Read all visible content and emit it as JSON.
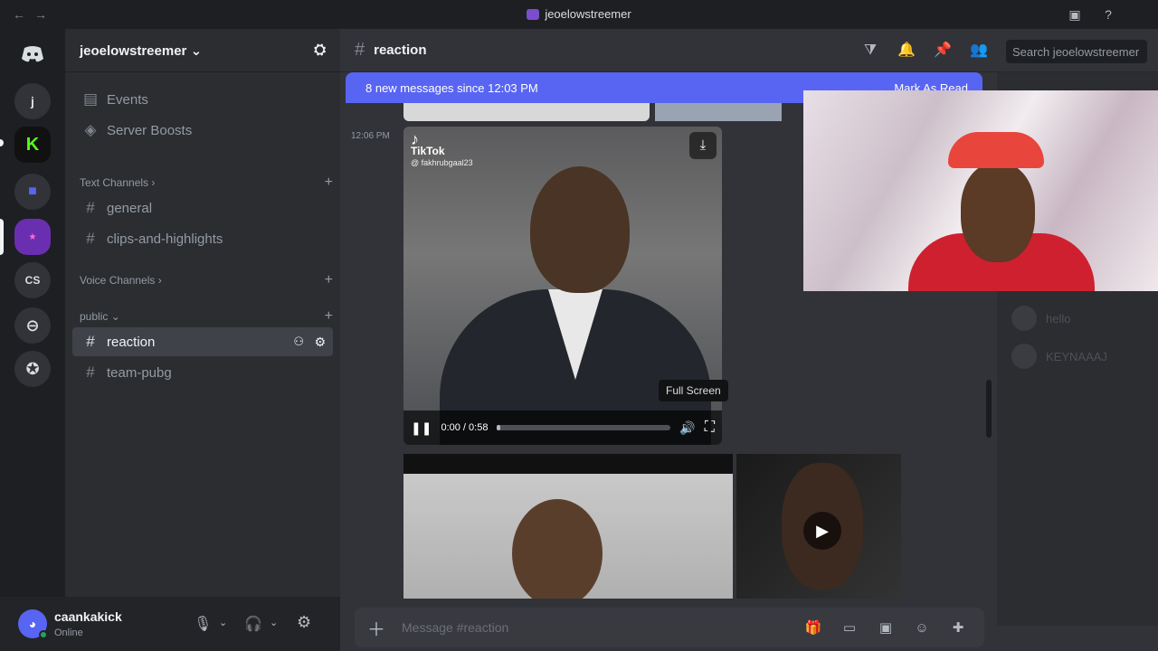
{
  "window": {
    "title": "jeoelowstreemer"
  },
  "guilds": {
    "items": [
      {
        "label": "j"
      },
      {
        "label": "CS"
      }
    ]
  },
  "server": {
    "name": "jeoelowstreemer",
    "menu": [
      {
        "label": "Events",
        "icon": "calendar-icon"
      },
      {
        "label": "Server Boosts",
        "icon": "boost-icon"
      }
    ],
    "categories": {
      "text": "Text Channels",
      "voice": "Voice Channels",
      "public": "public"
    },
    "text_channels": [
      {
        "label": "general"
      },
      {
        "label": "clips-and-highlights"
      }
    ],
    "public_channels": [
      {
        "label": "reaction",
        "active": true
      },
      {
        "label": "team-pubg"
      }
    ]
  },
  "user": {
    "name": "caankakick",
    "status": "Online"
  },
  "channel": {
    "name": "reaction"
  },
  "search": {
    "placeholder": "Search jeoelowstreemer"
  },
  "banner": {
    "text": "8 new messages since 12:03 PM",
    "action": "Mark As Read"
  },
  "message": {
    "timestamp": "12:06 PM",
    "video": {
      "platform": "TikTok",
      "handle": "@ fakhrubgaal23",
      "time": "0:00 / 0:58",
      "progress": 0.02
    },
    "tooltip": "Full Screen"
  },
  "members": [
    {
      "name": "hello"
    },
    {
      "name": "KEYNAAAJ"
    }
  ],
  "composer": {
    "placeholder": "Message #reaction"
  },
  "colors": {
    "blurple": "#5865f2",
    "online": "#23a55a"
  }
}
